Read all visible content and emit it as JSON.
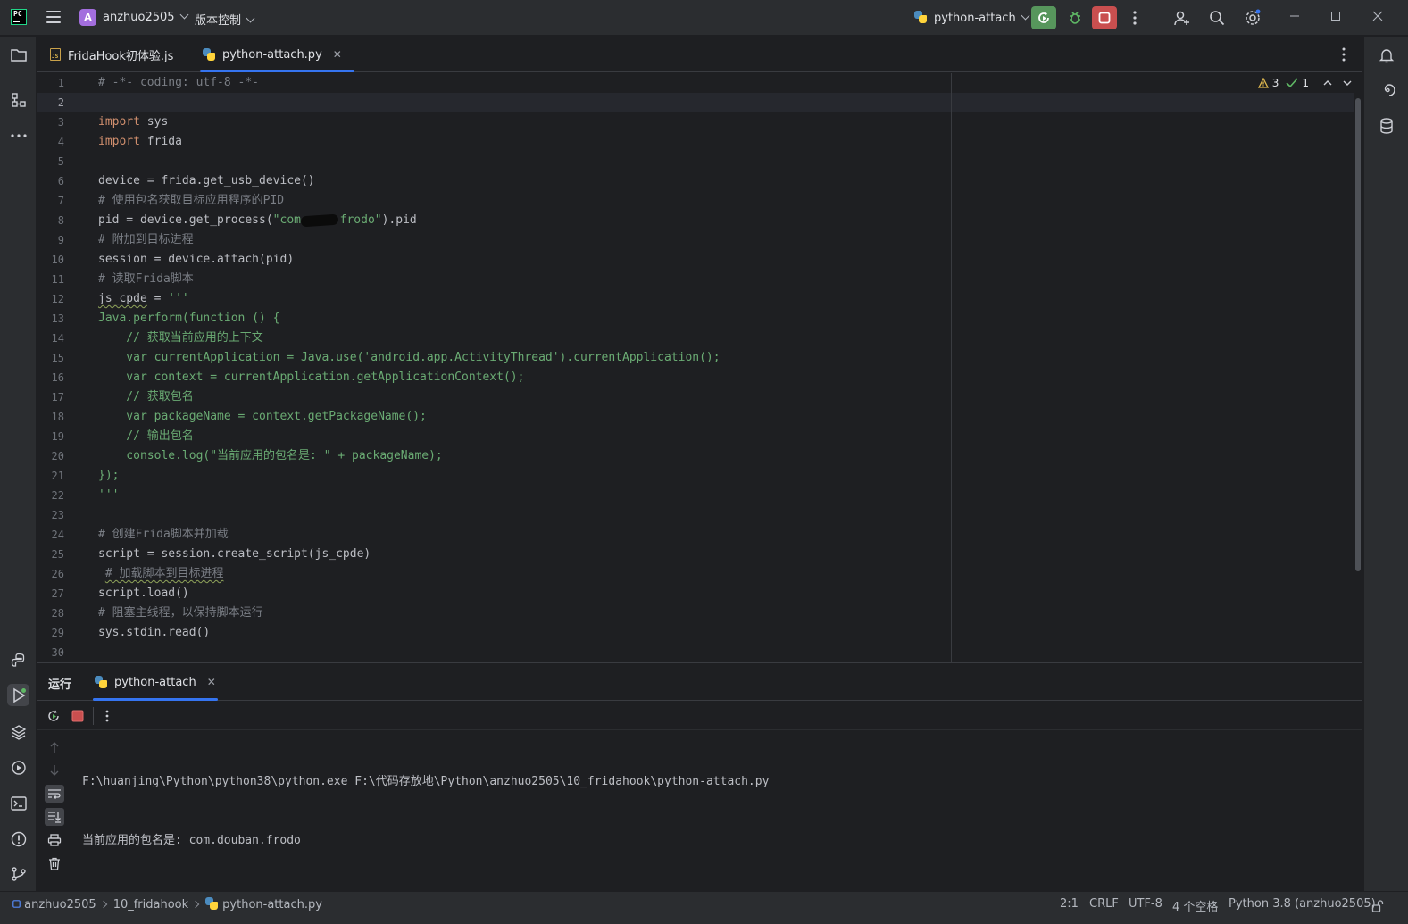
{
  "titlebar": {
    "logo_text": "PC",
    "project_initial": "A",
    "project_name": "anzhuo2505",
    "vcs_label": "版本控制",
    "run_config": "python-attach"
  },
  "tabs": [
    {
      "label": "FridaHook初体验.js",
      "active": false
    },
    {
      "label": "python-attach.py",
      "active": true
    }
  ],
  "inspections": {
    "warnings": "3",
    "ok": "1"
  },
  "editor": {
    "line_numbers": [
      "1",
      "2",
      "3",
      "4",
      "5",
      "6",
      "7",
      "8",
      "9",
      "10",
      "11",
      "12",
      "13",
      "14",
      "15",
      "16",
      "17",
      "18",
      "19",
      "20",
      "21",
      "22",
      "23",
      "24",
      "25",
      "26",
      "27",
      "28",
      "29",
      "30"
    ],
    "current_line": 2,
    "lines": {
      "l1": "# -*- coding: utf-8 -*-",
      "l3_kw": "import",
      "l3_rest": " sys",
      "l4_kw": "import",
      "l4_rest": " frida",
      "l6": "device = frida.get_usb_device()",
      "l7": "# 使用包名获取目标应用程序的PID",
      "l8_a": "pid = device.get_process(",
      "l8_str_a": "\"com.",
      "l8_str_b": ".frodo\"",
      "l8_b": ").pid",
      "l9": "# 附加到目标进程",
      "l10": "session = device.attach(pid)",
      "l11": "# 读取Frida脚本",
      "l12_a": "js_cpde",
      "l12_b": " = ",
      "l12_str": "'''",
      "l13": "Java.perform(function () {",
      "l14": "    // 获取当前应用的上下文",
      "l15": "    var currentApplication = Java.use('android.app.ActivityThread').currentApplication();",
      "l16": "    var context = currentApplication.getApplicationContext();",
      "l17": "    // 获取包名",
      "l18": "    var packageName = context.getPackageName();",
      "l19": "    // 输出包名",
      "l20": "    console.log(\"当前应用的包名是: \" + packageName);",
      "l21": "});",
      "l22": "'''",
      "l24": "# 创建Frida脚本并加载",
      "l25": "script = session.create_script(js_cpde)",
      "l26_pre": " ",
      "l26": "# 加载脚本到目标进程",
      "l27": "script.load()",
      "l28": "# 阻塞主线程，以保持脚本运行",
      "l29": "sys.stdin.read()"
    }
  },
  "run_panel": {
    "title": "运行",
    "tab_label": "python-attach",
    "console_lines": [
      "F:\\huanjing\\Python\\python38\\python.exe F:\\代码存放地\\Python\\anzhuo2505\\10_fridahook\\python-attach.py",
      "当前应用的包名是: com.douban.frodo"
    ]
  },
  "statusbar": {
    "breadcrumbs": [
      "anzhuo2505",
      "10_fridahook",
      "python-attach.py"
    ],
    "position": "2:1",
    "line_sep": "CRLF",
    "encoding": "UTF-8",
    "indent": "4 个空格",
    "interpreter": "Python 3.8 (anzhuo2505)"
  },
  "colors": {
    "accent": "#3574f0",
    "run_green": "#57965c",
    "stop_red": "#c94f4f",
    "keyword": "#cf8e6d",
    "string": "#6aab73",
    "comment": "#7a7e85"
  }
}
